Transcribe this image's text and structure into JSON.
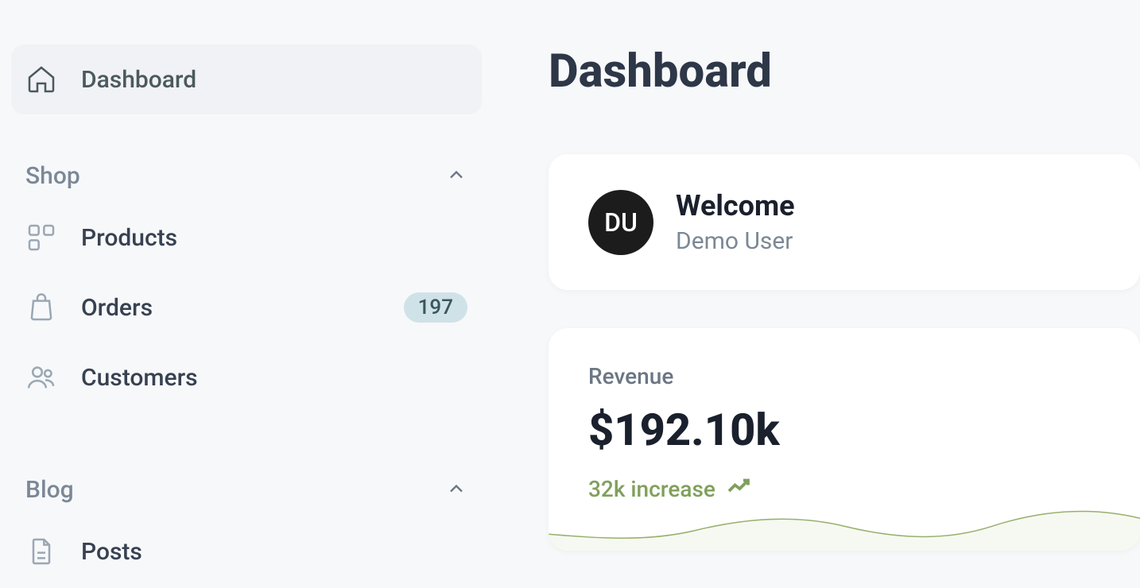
{
  "page": {
    "title": "Dashboard"
  },
  "sidebar": {
    "dashboard": {
      "label": "Dashboard"
    },
    "sections": {
      "shop": {
        "label": "Shop",
        "items": {
          "products": {
            "label": "Products"
          },
          "orders": {
            "label": "Orders",
            "badge": "197"
          },
          "customers": {
            "label": "Customers"
          }
        }
      },
      "blog": {
        "label": "Blog",
        "items": {
          "posts": {
            "label": "Posts"
          }
        }
      }
    }
  },
  "welcome": {
    "avatar_initials": "DU",
    "title": "Welcome",
    "subtitle": "Demo User"
  },
  "revenue": {
    "label": "Revenue",
    "value": "$192.10k",
    "change": "32k increase"
  }
}
